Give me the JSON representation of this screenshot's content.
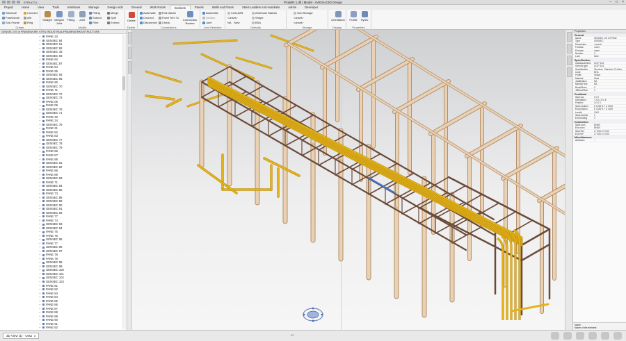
{
  "window": {
    "title": "ProjWN 1.dll | Model - AVEVA E3D Design",
    "quick_access_text": "STRUCTU..."
  },
  "ribbon_tabs": [
    "Project",
    "Home",
    "View",
    "Tools",
    "Interfaces",
    "Manage",
    "Design Aids",
    "General",
    "Work Packs",
    "Sections",
    "Panels",
    "Walls And Floors",
    "Stairs Ladders And Handrails",
    "Admin",
    "Developer"
  ],
  "active_tab_index": 9,
  "ribbon": {
    "create": {
      "label": "Create",
      "items": [
        "Structure",
        "Framework",
        "Sub-Frame"
      ],
      "small": [
        "Connect",
        "Attr",
        "Ring"
      ]
    },
    "modify": {
      "label": "Modify",
      "big": [
        "Straight",
        "Merged Joint",
        "Fitting",
        "Joint"
      ],
      "items": [
        "Fitting",
        "Subord",
        "Fillet",
        "Merge",
        "Split",
        "Extend"
      ],
      "extra": [
        "Split",
        "Trim"
      ]
    },
    "delete": {
      "label": "Delete",
      "big": "Delete"
    },
    "connections": {
      "label": "Connections",
      "items": [
        "Automatic",
        "Connect",
        "Disconnect"
      ],
      "items2": [
        "End Datum",
        "Fixed Trim To",
        "Check"
      ],
      "big": "Connection Review"
    },
    "joint_selection": {
      "label": "Joint Selection",
      "items": [
        "Automatic",
        "Section",
        "Joint"
      ]
    },
    "defaults": {
      "label": "Defaults",
      "items": [
        "COLUMN",
        "<unset>",
        "NA",
        "New"
      ],
      "items2": [
        "American Standa",
        "Shape",
        "BSA"
      ]
    },
    "storage": {
      "label": "Storage",
      "items": [
        "Grid Storage",
        "<unset>",
        "<unset>"
      ]
    },
    "display": {
      "label": "Display",
      "big": "Orientation"
    },
    "properties": {
      "label": "Properties",
      "big": [
        "Profile",
        "Hydro"
      ]
    }
  },
  "explorer": {
    "header": "GENSEC GS of FRAMEWORK STRU INDUSTRIAL/FRAMEWORKS/STRUCTURE",
    "items": [
      "PANE 33",
      "GENSEC 84",
      "GENSEC 91",
      "GENSEC 82",
      "GENSEC 45",
      "GENSEC 93",
      "PANE 92",
      "GENSEC 87",
      "PANE 94",
      "PANE 95",
      "GENSEC 93",
      "GENSEC 66",
      "PANE 90",
      "GENSEC 70",
      "PANE 71",
      "GENSEC 72",
      "GENSEC 73",
      "PANE 06",
      "PANE 09",
      "GENSEC 76",
      "GENSEC 71",
      "PANE 33",
      "PANE 34",
      "GENSEC 76",
      "PANE 31",
      "PANE 82",
      "PANE 83",
      "GENSEC 77",
      "GENSEC 78",
      "GENSEC 79",
      "PANE 86",
      "PANE 87",
      "PANE 88",
      "GENSEC 81",
      "GENSEC 82",
      "PANE 86",
      "PANE 89",
      "GENSEC 83",
      "PANE 71",
      "GENSEC 84",
      "GENSEC 85",
      "PANE 73",
      "GENSEC 88",
      "GENSEC 89",
      "GENSEC 90",
      "GENSEC 91",
      "GENSEC 92",
      "PANE 77",
      "PANE 74",
      "GENSEC 93",
      "GENSEC 94",
      "PANE 75",
      "PANE 76",
      "GENSEC 95",
      "PANE 77",
      "GENSEC 96",
      "GENSEC 97",
      "PANE 78",
      "PANE 79",
      "GENSEC 98",
      "GENSEC 99",
      "GENSEC 100",
      "GENSEC 101",
      "GENSEC 102",
      "GENSEC 103",
      "PANE 81",
      "PANE 82",
      "PANE 83",
      "PANE 84",
      "PANE 85",
      "PANE 86",
      "PANE 87",
      "PANE 88",
      "PANE 89",
      "PANE 90",
      "PANE 91",
      "PANE 92"
    ]
  },
  "properties": {
    "header": "Properties",
    "sections": [
      {
        "title": "General",
        "rows": [
          [
            "Name",
            "GENSEC GS of FRAM"
          ],
          [
            "Type",
            "GENSEC"
          ],
          [
            "Description",
            "<unset>"
          ],
          [
            "Function",
            "unset"
          ],
          [
            "Purpose",
            "unset"
          ],
          [
            "Number",
            "0"
          ],
          [
            "Lock",
            "false"
          ]
        ]
      },
      {
        "title": "Spec/Section",
        "rows": [
          [
            "Catalogue/Spec",
            "UC/P 3/11"
          ],
          [
            "Generic type",
            "UC/P 3/11"
          ],
          [
            "Specification",
            "Structure_Standard_Profiles"
          ],
          [
            "Code",
            "BHA"
          ],
          [
            "Profile",
            "Shape"
          ],
          [
            "Material",
            "Steel"
          ],
          [
            "Justification",
            "NA"
          ],
          [
            "Member line",
            "NA"
          ],
          [
            "Bend/Slope",
            "0"
          ],
          [
            "Jt/Bend/Rad",
            "0"
          ]
        ]
      },
      {
        "title": "Positional",
        "rows": [
          [
            "Start pos",
            "0 0 0"
          ],
          [
            "Orientation",
            "Y Is U Z Is E"
          ],
          [
            "Position",
            "0.0 0 0"
          ],
          [
            "Start position",
            "E 1345 N 7 U 3000"
          ],
          [
            "End position",
            "E 1345 N 7 U 4000"
          ],
          [
            "Length",
            "1000"
          ],
          [
            "Start bearing",
            "0"
          ],
          [
            "End bearing",
            "0"
          ]
        ]
      },
      {
        "title": "Connection",
        "rows": [
          [
            "Start conn",
            "BHAR"
          ],
          [
            "End conn",
            "BHAR"
          ],
          [
            "Start Ref",
            "Q 7000 Q 7000"
          ],
          [
            "End Ref",
            "Q 7000 Q 7000"
          ]
        ]
      },
      {
        "title": "Miscellaneous",
        "rows": [
          [
            "Attributes",
            "..."
          ]
        ]
      }
    ],
    "footer_title": "Name",
    "footer_text": "Name of the element"
  },
  "statusbar": {
    "view_tab": "3D View (1) - Unta",
    "close_glyph": "x",
    "page_marker": "22"
  },
  "colors": {
    "pipe": "#e3b31a",
    "pipe_shadow": "#b98a0e",
    "steel_frame": "#6b4a38",
    "column": "#e8d1b5",
    "column_edge": "#b58f68",
    "blue_member": "#3f74c9",
    "accent": "#3277c5"
  }
}
